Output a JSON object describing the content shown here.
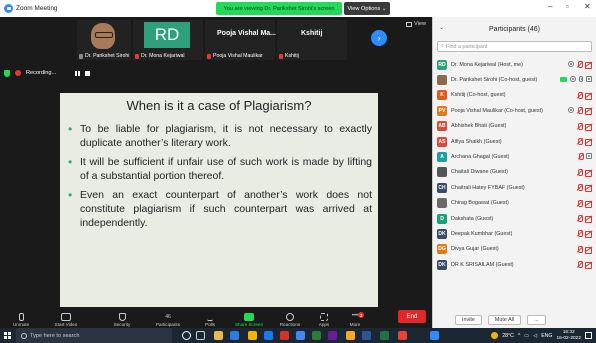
{
  "window": {
    "title": "Zoom Meeting",
    "viewing_banner": "You are viewing Dr. Parikshet Sirohi's screen",
    "view_options": "View Options ⌄",
    "controls": {
      "minimize": "–",
      "maximize": "▫",
      "close": "✕"
    }
  },
  "video_strip": {
    "tiles": [
      {
        "name": "Dr. Parikshet Sirohi",
        "type": "video"
      },
      {
        "name": "Dr. Mona Kejariwal",
        "initials": "RD",
        "type": "initials"
      },
      {
        "name": "Pooja Vishal Maulikar",
        "display": "Pooja Vishal Ma...",
        "type": "name"
      },
      {
        "name": "Kshitij",
        "display": "Kshitij",
        "type": "name"
      }
    ],
    "next_arrow": "›",
    "view_label": "View"
  },
  "recording": {
    "label": "Recording..."
  },
  "slide": {
    "title": "When is it a case of Plagiarism?",
    "bullets": [
      "To be liable for plagiarism, it is not necessary to exactly duplicate another’s literary work.",
      "It will be sufficient if unfair use of such work is made by lifting of a substantial portion thereof.",
      "Even an exact counterpart of another’s work does not constitute plagiarism if such counterpart was arrived at independently."
    ]
  },
  "toolbar": {
    "unmute": "Unmute",
    "start_video": "Start Video",
    "security": "Security",
    "participants": "Participants",
    "participants_count": "46",
    "polls": "Polls",
    "share_screen": "Share Screen",
    "reactions": "Reactions",
    "apps": "Apps",
    "more": "More",
    "more_badge": "3",
    "end": "End"
  },
  "panel": {
    "title": "Participants (46)",
    "search_placeholder": "Find a participant",
    "participants": [
      {
        "initials": "RD",
        "color": "#2ea07c",
        "name": "Dr. Mona Kejariwal (Host, me)",
        "icons": [
          "rec",
          "mic-off",
          "cam-off"
        ]
      },
      {
        "initials": "",
        "color": "#8a6a4a",
        "name": "Dr. Parikshet Sirohi (Co-host, guest)",
        "icons": [
          "share",
          "rec",
          "mic",
          "cam"
        ]
      },
      {
        "initials": "K",
        "color": "#e05a1c",
        "name": "Kshitij (Co-host, guest)",
        "icons": [
          "mic-off",
          "cam-off"
        ]
      },
      {
        "initials": "PV",
        "color": "#e07a1c",
        "name": "Pooja Vishal Maulikar (Co-host, guest)",
        "icons": [
          "rec",
          "mic-off",
          "cam-off"
        ]
      },
      {
        "initials": "AB",
        "color": "#d94a3a",
        "name": "Abhishek Bhati (Guest)",
        "icons": [
          "mic-off",
          "cam-off"
        ]
      },
      {
        "initials": "AS",
        "color": "#d94a3a",
        "name": "Alfiya Shaikh (Guest)",
        "icons": [
          "mic-off",
          "cam-off"
        ]
      },
      {
        "initials": "A",
        "color": "#1aa1a1",
        "name": "Archana Ghagal (Guest)",
        "icons": [
          "mic-off",
          "cam"
        ]
      },
      {
        "initials": "",
        "color": "#555555",
        "name": "Chaitali Diwane (Guest)",
        "icons": [
          "mic-off",
          "cam-off"
        ]
      },
      {
        "initials": "CH",
        "color": "#3a4a6a",
        "name": "Chaitrali Hatey FYBAF (Guest)",
        "icons": [
          "mic-off",
          "cam-off"
        ]
      },
      {
        "initials": "",
        "color": "#6a6a6a",
        "name": "Chirag Bogawat (Guest)",
        "icons": [
          "mic-off",
          "cam-off"
        ]
      },
      {
        "initials": "D",
        "color": "#1aa17a",
        "name": "Dakshata (Guest)",
        "icons": [
          "mic-off",
          "cam-off"
        ]
      },
      {
        "initials": "DK",
        "color": "#3a4a6a",
        "name": "Deepak Kumbhar (Guest)",
        "icons": [
          "mic-off",
          "cam-off"
        ]
      },
      {
        "initials": "DG",
        "color": "#e07a1c",
        "name": "Divya Gujar (Guest)",
        "icons": [
          "mic-off",
          "cam-off"
        ]
      },
      {
        "initials": "DK",
        "color": "#3a4a6a",
        "name": "DR K SRISAILAM (Guest)",
        "icons": [
          "mic-off",
          "cam-off"
        ]
      }
    ],
    "invite": "Invite",
    "mute_all": "Mute All",
    "more": "..."
  },
  "taskbar": {
    "search_placeholder": "Type here to search",
    "weather": "28°C",
    "language": "ENG",
    "time": "16:32",
    "date": "15-02-2022"
  }
}
